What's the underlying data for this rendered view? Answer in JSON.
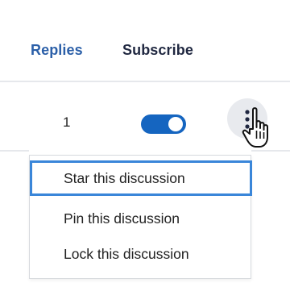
{
  "table": {
    "columns": {
      "replies": "Replies",
      "subscribe": "Subscribe"
    },
    "row": {
      "reply_count": "1",
      "subscribed": true
    }
  },
  "menu": {
    "items": [
      {
        "label": "Star this discussion",
        "focused": true
      },
      {
        "label": "Pin this discussion",
        "focused": false
      },
      {
        "label": "Lock this discussion",
        "focused": false
      }
    ]
  },
  "icons": {
    "more": "vertical-ellipsis-icon",
    "cursor": "hand-pointer-icon"
  },
  "colors": {
    "replies_header": "#2b5fa8",
    "subscribe_header": "#1f2740",
    "toggle_on": "#1565c0",
    "focus_ring": "#3a86d9"
  }
}
